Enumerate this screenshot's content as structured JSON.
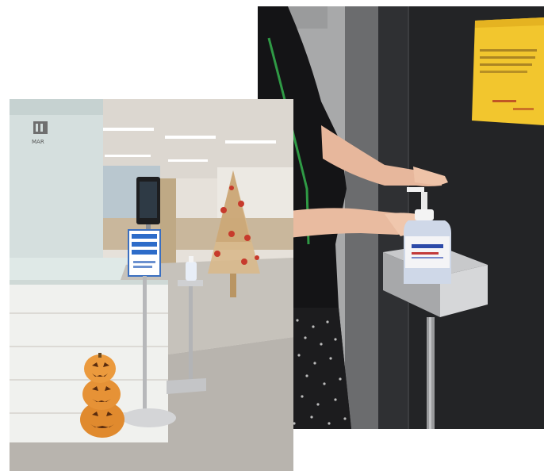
{
  "photos": [
    {
      "name": "hand-sanitizer-photo",
      "signage": {
        "notice_title": "",
        "notice_text": "",
        "bottle_label": ""
      }
    },
    {
      "name": "office-reception-photo",
      "signage": {
        "logo_text": "MAR",
        "stand_sign_text": ""
      }
    }
  ]
}
